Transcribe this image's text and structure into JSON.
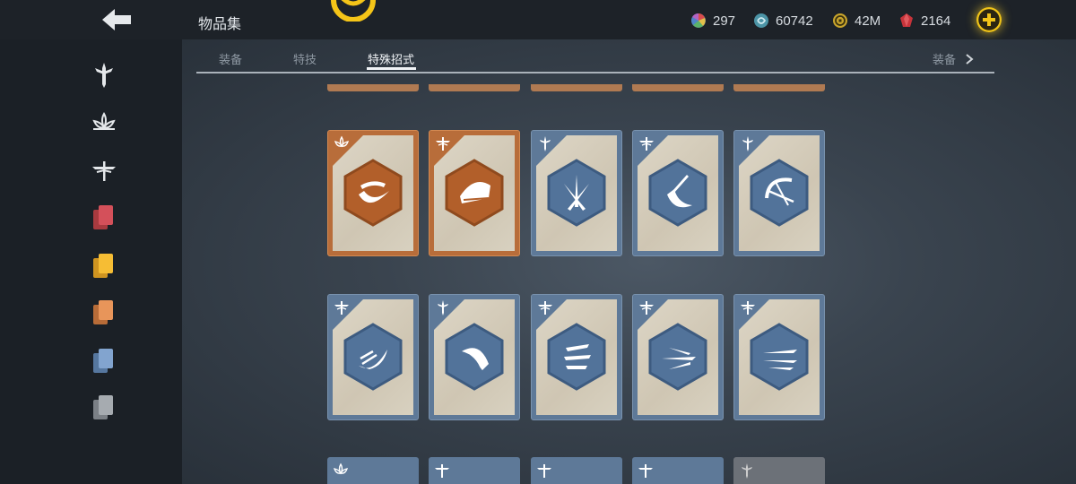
{
  "header": {
    "title": "物品集",
    "currencies": [
      {
        "icon": "prism-icon",
        "value": "297",
        "color": "#c0c0c0"
      },
      {
        "icon": "swirl-coin-icon",
        "value": "60742",
        "color": "#5fa8b8"
      },
      {
        "icon": "gold-coin-icon",
        "value": "42M",
        "color": "#d6b23a"
      },
      {
        "icon": "ruby-icon",
        "value": "2164",
        "color": "#d23a3a"
      }
    ]
  },
  "tabs": [
    {
      "label": "装备"
    },
    {
      "label": "特技"
    },
    {
      "label": "特殊招式"
    }
  ],
  "more_tab": {
    "label": "装备"
  },
  "sidebar": [
    {
      "icon": "sword-emblem-icon"
    },
    {
      "icon": "lotus-emblem-icon"
    },
    {
      "icon": "dragonfly-emblem-icon"
    },
    {
      "icon": "red-cards-icon",
      "color": "#c9454a"
    },
    {
      "icon": "yellow-cards-icon",
      "color": "#f2b233"
    },
    {
      "icon": "orange-cards-icon",
      "color": "#e08a4a"
    },
    {
      "icon": "blue-cards-icon",
      "color": "#6f93c4"
    },
    {
      "icon": "gray-cards-icon",
      "color": "#9aa0a6"
    }
  ],
  "cards_row1": [
    {
      "rarity": "orange",
      "badge": "lotus-emblem-icon",
      "move": "crescent-slash-icon"
    },
    {
      "rarity": "orange",
      "badge": "dragonfly-emblem-icon",
      "move": "sweeping-fist-icon"
    },
    {
      "rarity": "blue",
      "badge": "sword-emblem-icon",
      "move": "crossed-swords-icon"
    },
    {
      "rarity": "blue",
      "badge": "dragonfly-emblem-icon",
      "move": "blade-arc-icon"
    },
    {
      "rarity": "blue",
      "badge": "sword-emblem-icon",
      "move": "bow-shot-icon"
    }
  ],
  "cards_row2": [
    {
      "rarity": "blue",
      "badge": "dragonfly-emblem-icon",
      "move": "claw-slash-icon"
    },
    {
      "rarity": "blue",
      "badge": "sword-emblem-icon",
      "move": "crescent-blade-icon"
    },
    {
      "rarity": "blue",
      "badge": "dragonfly-emblem-icon",
      "move": "triple-strike-icon"
    },
    {
      "rarity": "blue",
      "badge": "dragonfly-emblem-icon",
      "move": "dagger-throw-icon"
    },
    {
      "rarity": "blue",
      "badge": "dragonfly-emblem-icon",
      "move": "dagger-volley-icon"
    }
  ],
  "cards_row3_partial": [
    {
      "rarity": "blue",
      "badge": "lotus-emblem-icon"
    },
    {
      "rarity": "blue",
      "badge": "dragonfly-emblem-icon"
    },
    {
      "rarity": "blue",
      "badge": "dragonfly-emblem-icon"
    },
    {
      "rarity": "blue",
      "badge": "dragonfly-emblem-icon"
    },
    {
      "rarity": "gray",
      "badge": "sword-emblem-icon"
    }
  ]
}
